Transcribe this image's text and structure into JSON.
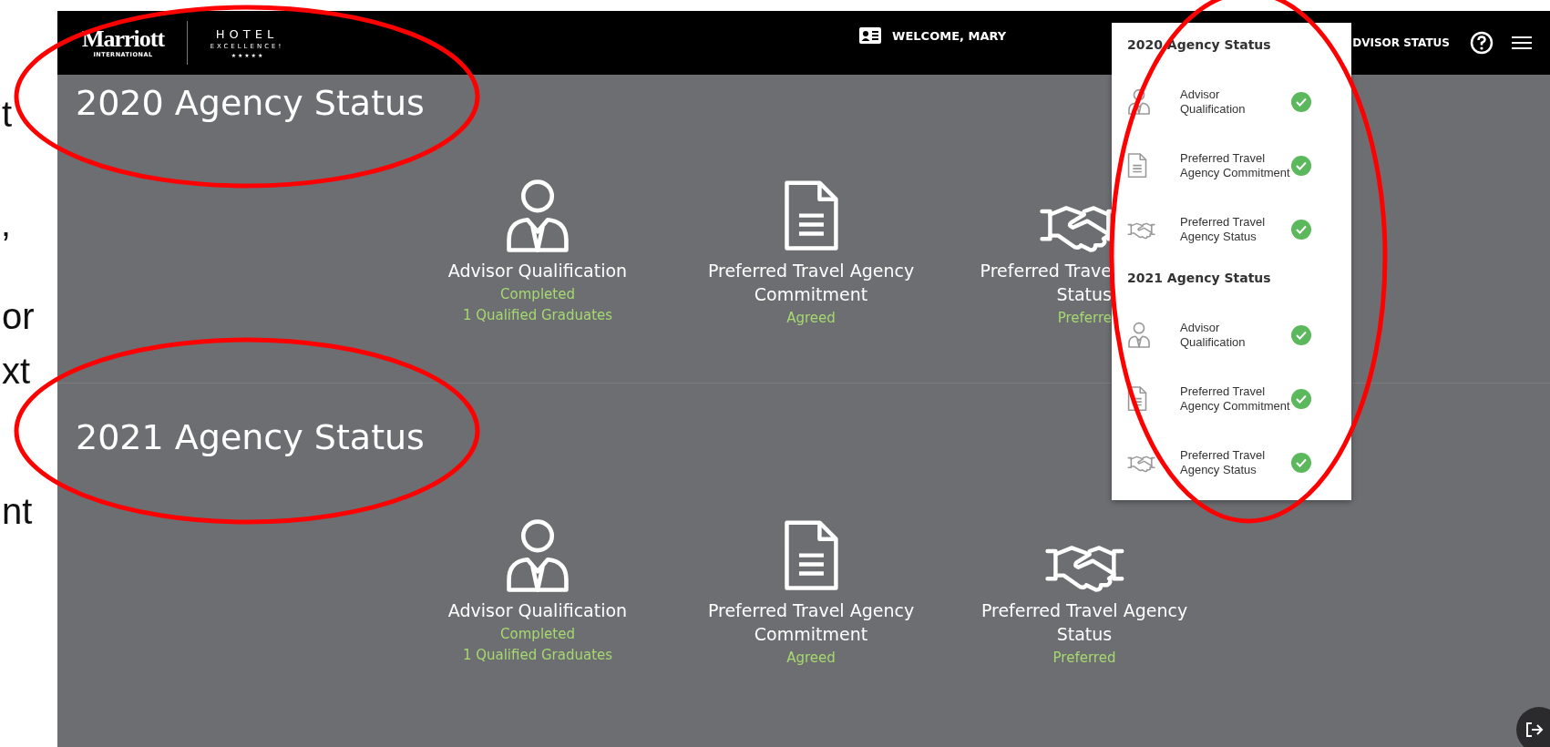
{
  "slide_fragments": [
    "t",
    "’",
    "or",
    "xt",
    "nt"
  ],
  "header": {
    "brand": "Marriott",
    "brand_sub": "INTERNATIONAL",
    "program_title": "HOTEL",
    "program_subtitle": "EXCELLENCE!",
    "program_stars": "★ ★ ★ ★ ★",
    "welcome": "WELCOME, MARY",
    "nav_link": "DVISOR STATUS"
  },
  "sections": [
    {
      "title": "2020 Agency Status",
      "cards": [
        {
          "kind": "advisor",
          "cut": false,
          "label": [
            "Advisor Qualification"
          ],
          "status": [
            "Completed",
            "1 Qualified Graduates"
          ]
        },
        {
          "kind": "document",
          "cut": false,
          "label": [
            "Preferred Travel Agency",
            "Commitment"
          ],
          "status": [
            "Agreed"
          ]
        },
        {
          "kind": "handshake",
          "cut": true,
          "label": [
            "Preferred Trave",
            "Status"
          ],
          "status": [
            "Preferre"
          ]
        }
      ]
    },
    {
      "title": "2021 Agency Status",
      "cards": [
        {
          "kind": "advisor",
          "cut": false,
          "label": [
            "Advisor Qualification"
          ],
          "status": [
            "Completed",
            "1 Qualified Graduates"
          ]
        },
        {
          "kind": "document",
          "cut": false,
          "label": [
            "Preferred Travel Agency",
            "Commitment"
          ],
          "status": [
            "Agreed"
          ]
        },
        {
          "kind": "handshake",
          "cut": false,
          "label": [
            "Preferred Travel Agency",
            "Status"
          ],
          "status": [
            "Preferred"
          ]
        }
      ]
    }
  ],
  "dropdown": {
    "groups": [
      {
        "title": "2020 Agency Status",
        "items": [
          {
            "kind": "advisor",
            "label": [
              "Advisor",
              "Qualification"
            ],
            "completed": true
          },
          {
            "kind": "document",
            "label": [
              "Preferred Travel",
              "Agency Commitment"
            ],
            "completed": true
          },
          {
            "kind": "handshake",
            "label": [
              "Preferred Travel",
              "Agency Status"
            ],
            "completed": true
          }
        ]
      },
      {
        "title": "2021 Agency Status",
        "items": [
          {
            "kind": "advisor",
            "label": [
              "Advisor",
              "Qualification"
            ],
            "completed": true
          },
          {
            "kind": "document",
            "label": [
              "Preferred Travel",
              "Agency Commitment"
            ],
            "completed": true
          },
          {
            "kind": "handshake",
            "label": [
              "Preferred Travel",
              "Agency Status"
            ],
            "completed": true
          }
        ]
      }
    ]
  }
}
